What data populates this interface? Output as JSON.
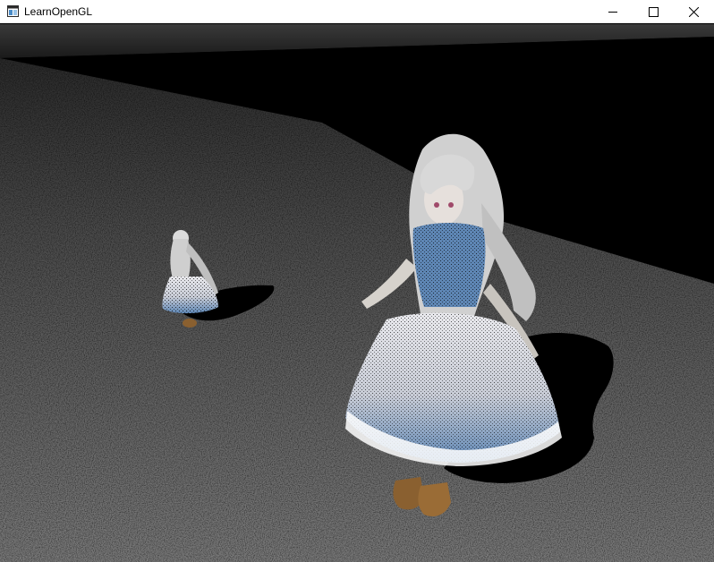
{
  "window": {
    "title": "LearnOpenGL",
    "app_icon": "opengl-app-icon",
    "controls": {
      "minimize_icon": "minimize-icon",
      "maximize_icon": "maximize-icon",
      "close_icon": "close-icon"
    }
  },
  "scene": {
    "description_icon": "rendered-3d-scene",
    "floor_color": "#6a6a6a",
    "dress_color": "#5e86b4",
    "hair_color": "#d8d8d8",
    "boot_color": "#8a6030"
  }
}
